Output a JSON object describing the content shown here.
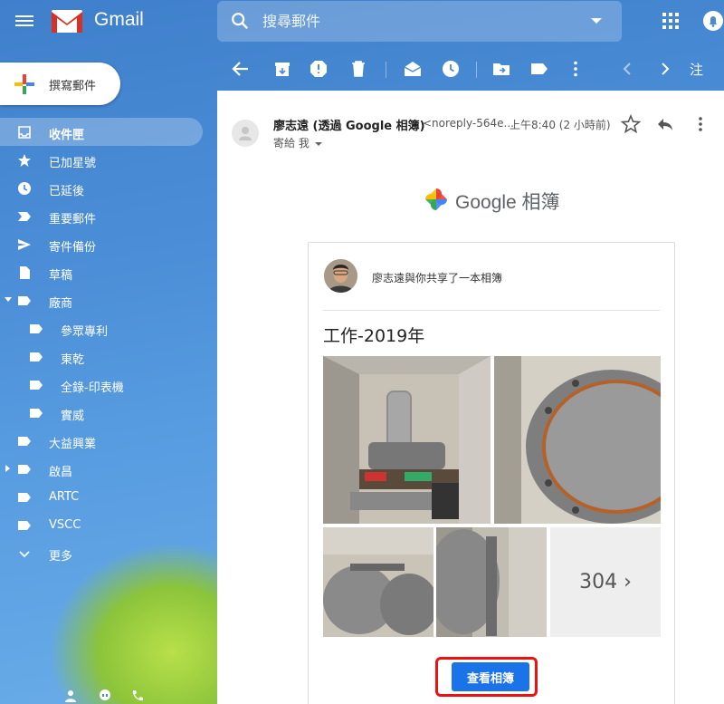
{
  "app": {
    "name": "Gmail"
  },
  "search": {
    "placeholder": "搜尋郵件"
  },
  "compose": {
    "label": "撰寫郵件"
  },
  "sidebar": {
    "items": [
      {
        "label": "收件匣",
        "icon": "inbox-icon",
        "active": true
      },
      {
        "label": "已加星號",
        "icon": "star-icon"
      },
      {
        "label": "已延後",
        "icon": "clock-icon"
      },
      {
        "label": "重要郵件",
        "icon": "important-icon"
      },
      {
        "label": "寄件備份",
        "icon": "send-icon"
      },
      {
        "label": "草稿",
        "icon": "draft-icon"
      },
      {
        "label": "廠商",
        "icon": "label-icon",
        "caret": "down"
      },
      {
        "label": "參眾專利",
        "icon": "label-icon",
        "sub": true
      },
      {
        "label": "東乾",
        "icon": "label-icon",
        "sub": true
      },
      {
        "label": "全錄-印表機",
        "icon": "label-icon",
        "sub": true
      },
      {
        "label": "實威",
        "icon": "label-icon",
        "sub": true
      },
      {
        "label": "大益興業",
        "icon": "label-icon"
      },
      {
        "label": "啟昌",
        "icon": "label-icon",
        "caret": "right"
      },
      {
        "label": "ARTC",
        "icon": "label-icon"
      },
      {
        "label": "VSCC",
        "icon": "label-icon"
      },
      {
        "label": "更多",
        "icon": "expand-more-icon"
      }
    ]
  },
  "toolbar": {
    "more_label": "注"
  },
  "message": {
    "sender_name": "廖志遠 (透過 Google 相簿)",
    "sender_email": "<noreply-564e...",
    "time": "上午8:40 (2 小時前)",
    "to": "寄給 我"
  },
  "email_body": {
    "logo_text": "Google 相簿",
    "share_text": "廖志遠與你共享了一本相簿",
    "album_title": "工作-2019年",
    "more_count": "304 ›",
    "view_button": "查看相簿"
  },
  "colors": {
    "accent": "#1a73e8",
    "highlight_outline": "#ee1111",
    "pane_bg": "#ffffff"
  }
}
